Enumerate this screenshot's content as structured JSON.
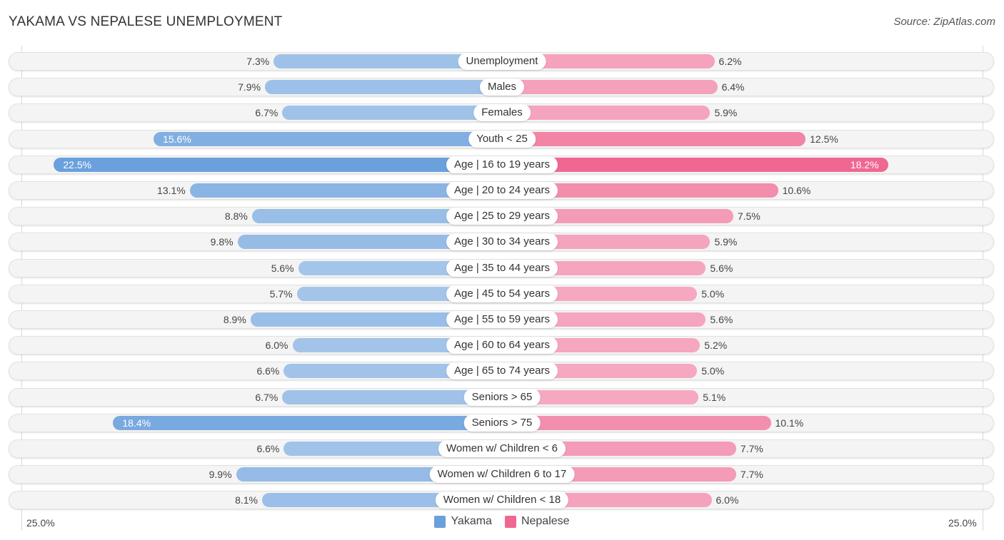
{
  "header": {
    "title": "YAKAMA VS NEPALESE UNEMPLOYMENT",
    "source": "Source: ZipAtlas.com"
  },
  "colors": {
    "yakama_strong": "#6aa0dc",
    "yakama_light": "#a6c6ea",
    "nepalese_strong": "#f06892",
    "nepalese_light": "#f5a8c0"
  },
  "chart_data": {
    "type": "bar",
    "orientation": "horizontal-diverging",
    "title": "YAKAMA VS NEPALESE UNEMPLOYMENT",
    "xlabel": "",
    "ylabel": "",
    "xlim": [
      0,
      25.0
    ],
    "axis_labels": {
      "left": "25.0%",
      "right": "25.0%"
    },
    "legend": {
      "position": "bottom-center",
      "entries": [
        "Yakama",
        "Nepalese"
      ]
    },
    "categories": [
      "Unemployment",
      "Males",
      "Females",
      "Youth < 25",
      "Age | 16 to 19 years",
      "Age | 20 to 24 years",
      "Age | 25 to 29 years",
      "Age | 30 to 34 years",
      "Age | 35 to 44 years",
      "Age | 45 to 54 years",
      "Age | 55 to 59 years",
      "Age | 60 to 64 years",
      "Age | 65 to 74 years",
      "Seniors > 65",
      "Seniors > 75",
      "Women w/ Children < 6",
      "Women w/ Children 6 to 17",
      "Women w/ Children < 18"
    ],
    "series": [
      {
        "name": "Yakama",
        "side": "left",
        "values": [
          7.3,
          7.9,
          6.7,
          15.6,
          22.5,
          13.1,
          8.8,
          9.8,
          5.6,
          5.7,
          8.9,
          6.0,
          6.6,
          6.7,
          18.4,
          6.6,
          9.9,
          8.1
        ],
        "labels": [
          "7.3%",
          "7.9%",
          "6.7%",
          "15.6%",
          "22.5%",
          "13.1%",
          "8.8%",
          "9.8%",
          "5.6%",
          "5.7%",
          "8.9%",
          "6.0%",
          "6.6%",
          "6.7%",
          "18.4%",
          "6.6%",
          "9.9%",
          "8.1%"
        ]
      },
      {
        "name": "Nepalese",
        "side": "right",
        "values": [
          6.2,
          6.4,
          5.9,
          12.5,
          18.2,
          10.6,
          7.5,
          5.9,
          5.6,
          5.0,
          5.6,
          5.2,
          5.0,
          5.1,
          10.1,
          7.7,
          7.7,
          6.0
        ],
        "labels": [
          "6.2%",
          "6.4%",
          "5.9%",
          "12.5%",
          "18.2%",
          "10.6%",
          "7.5%",
          "5.9%",
          "5.6%",
          "5.0%",
          "5.6%",
          "5.2%",
          "5.0%",
          "5.1%",
          "10.1%",
          "7.7%",
          "7.7%",
          "6.0%"
        ]
      }
    ]
  }
}
